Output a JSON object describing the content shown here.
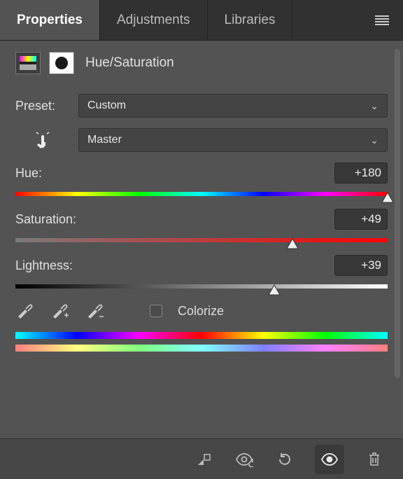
{
  "tabs": {
    "properties": "Properties",
    "adjustments": "Adjustments",
    "libraries": "Libraries",
    "active": "properties"
  },
  "header": {
    "title": "Hue/Saturation"
  },
  "preset": {
    "label": "Preset:",
    "value": "Custom"
  },
  "channel": {
    "value": "Master"
  },
  "sliders": {
    "hue": {
      "label": "Hue:",
      "value": "+180",
      "percent": 100
    },
    "saturation": {
      "label": "Saturation:",
      "value": "+49",
      "percent": 74.5
    },
    "lightness": {
      "label": "Lightness:",
      "value": "+39",
      "percent": 69.5
    }
  },
  "colorize": {
    "label": "Colorize",
    "checked": false
  }
}
